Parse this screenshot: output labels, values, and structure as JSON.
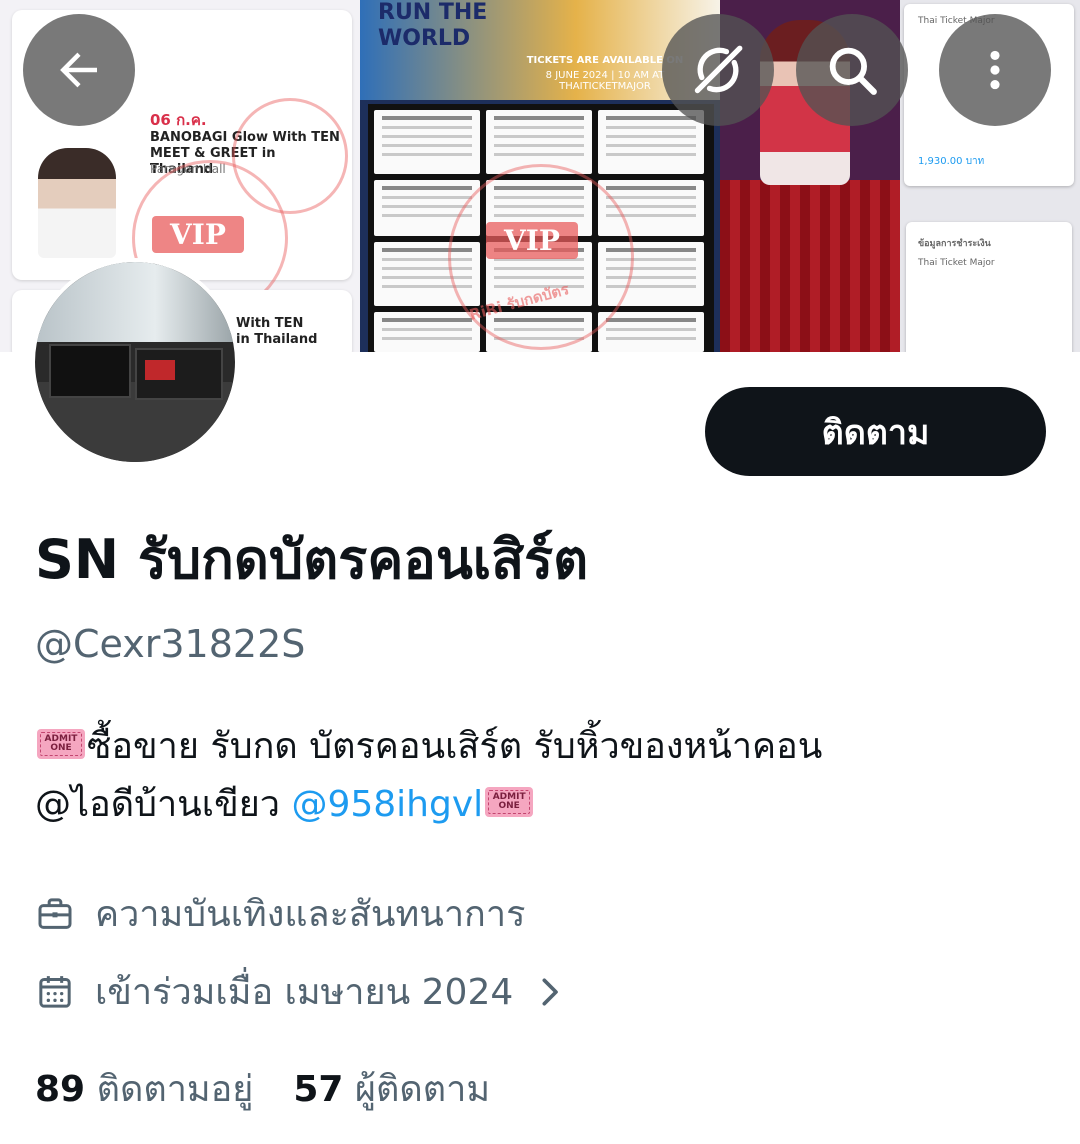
{
  "banner": {
    "event_date": "06 ก.ค.",
    "event_title": "BANOBAGI Glow With TEN MEET & GREET in Thailand",
    "event_venue": "Paragon Hall",
    "event_title_2": "With TEN\nin Thailand",
    "poster_title": "RUN THE WORLD",
    "poster_tickets": "TICKETS ARE AVAILABLE ON",
    "poster_date": "8 JUNE 2024 | 10 AM AT THAITICKETMAJOR",
    "vip_label": "VIP",
    "stamp_text": "RiRi รับกดบัตร",
    "receipt_vendor": "Thai Ticket Major",
    "receipt_price": "1,930.00 บาท",
    "receipt_heading": "ข้อมูลการชำระเงิน"
  },
  "nav": {
    "back_icon": "arrow-left-icon",
    "grok_icon": "grok-icon",
    "search_icon": "search-icon",
    "more_icon": "more-vertical-icon"
  },
  "profile": {
    "follow_label": "ติดตาม",
    "display_name": "SN รับกดบัตรคอนเสิร์ต",
    "handle": "@Cexr31822S",
    "bio_line1_text": "ซื้อขาย รับกด บัตรคอนเสิร์ต รับหิ้วของหน้าคอน",
    "bio_line2_text": "@ไอดีบ้านเขียว ",
    "bio_link": "@958ihgvl",
    "admit_label": "ADMIT ONE",
    "category": "ความบันเทิงและสันทนาการ",
    "joined": "เข้าร่วมเมื่อ เมษายน 2024",
    "following_count": "89",
    "following_label": "ติดตามอยู่",
    "followers_count": "57",
    "followers_label": "ผู้ติดตาม"
  },
  "colors": {
    "text_primary": "#0f1419",
    "text_secondary": "#536471",
    "link": "#1d9bf0",
    "follow_bg": "#0f1419"
  }
}
